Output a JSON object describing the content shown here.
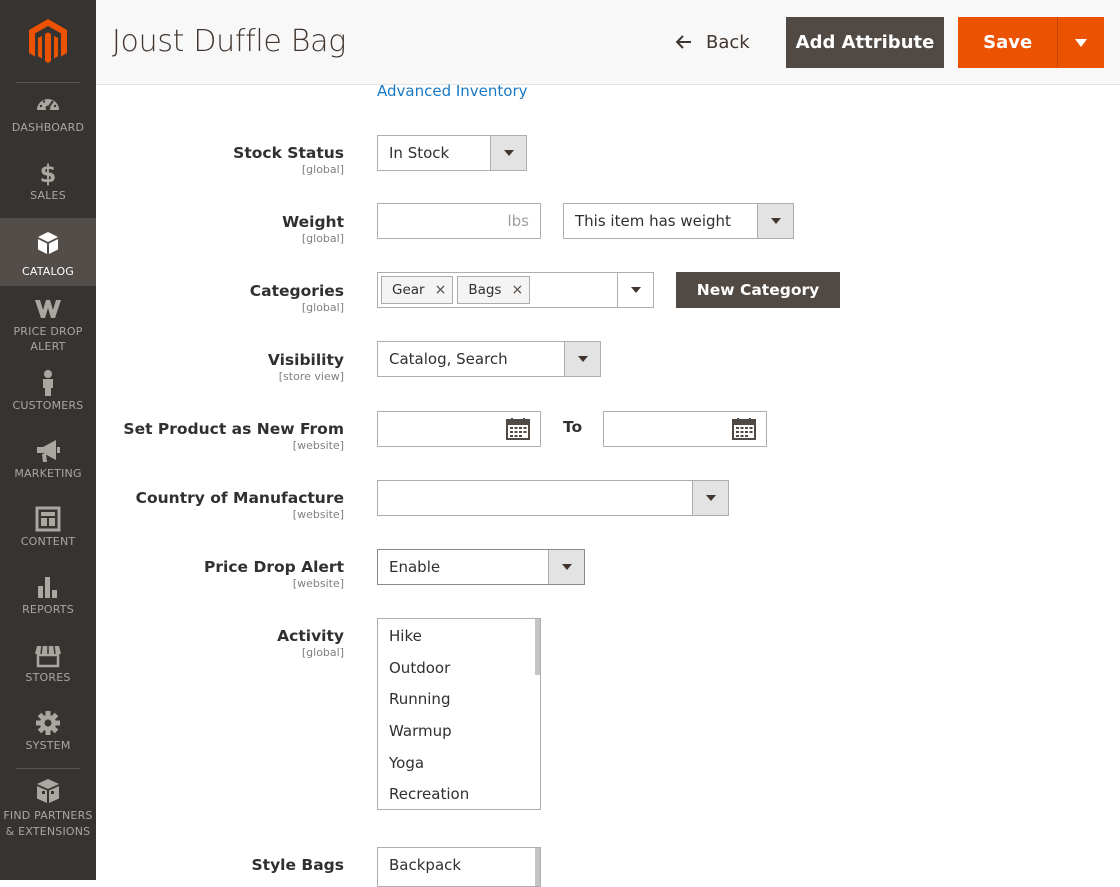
{
  "sidebar": {
    "items": [
      {
        "label": "Dashboard",
        "icon": "dashboard-icon"
      },
      {
        "label": "Sales",
        "icon": "dollar-icon"
      },
      {
        "label": "Catalog",
        "icon": "box-icon",
        "active": true
      },
      {
        "label": "Price Drop Alert",
        "icon": "price-drop-icon"
      },
      {
        "label": "Customers",
        "icon": "person-icon"
      },
      {
        "label": "Marketing",
        "icon": "megaphone-icon"
      },
      {
        "label": "Content",
        "icon": "layout-icon"
      },
      {
        "label": "Reports",
        "icon": "bar-chart-icon"
      },
      {
        "label": "Stores",
        "icon": "store-icon"
      },
      {
        "label": "System",
        "icon": "gear-icon"
      },
      {
        "label": "Find Partners & Extensions",
        "icon": "extensions-icon"
      }
    ]
  },
  "header": {
    "title": "Joust Duffle Bag",
    "back_label": "Back",
    "add_attribute_label": "Add Attribute",
    "save_label": "Save"
  },
  "form": {
    "advanced_inventory_link": "Advanced Inventory",
    "stock_status": {
      "label": "Stock Status",
      "scope": "[global]",
      "value": "In Stock"
    },
    "weight": {
      "label": "Weight",
      "scope": "[global]",
      "value": "",
      "unit": "lbs",
      "type_value": "This item has weight"
    },
    "categories": {
      "label": "Categories",
      "scope": "[global]",
      "tags": [
        "Gear",
        "Bags"
      ],
      "new_category_label": "New Category"
    },
    "visibility": {
      "label": "Visibility",
      "scope": "[store view]",
      "value": "Catalog, Search"
    },
    "new_from": {
      "label": "Set Product as New From",
      "scope": "[website]",
      "from_value": "",
      "to_label": "To",
      "to_value": ""
    },
    "country": {
      "label": "Country of Manufacture",
      "scope": "[website]",
      "value": ""
    },
    "price_drop": {
      "label": "Price Drop Alert",
      "scope": "[website]",
      "value": "Enable"
    },
    "activity": {
      "label": "Activity",
      "scope": "[global]",
      "options": [
        "Hike",
        "Outdoor",
        "Running",
        "Warmup",
        "Yoga",
        "Recreation"
      ]
    },
    "style_bags": {
      "label": "Style Bags",
      "options": [
        "Backpack"
      ]
    }
  },
  "colors": {
    "primary": "#eb5202",
    "sidebar": "#373330",
    "dark_button": "#514943",
    "link": "#1979c3"
  }
}
